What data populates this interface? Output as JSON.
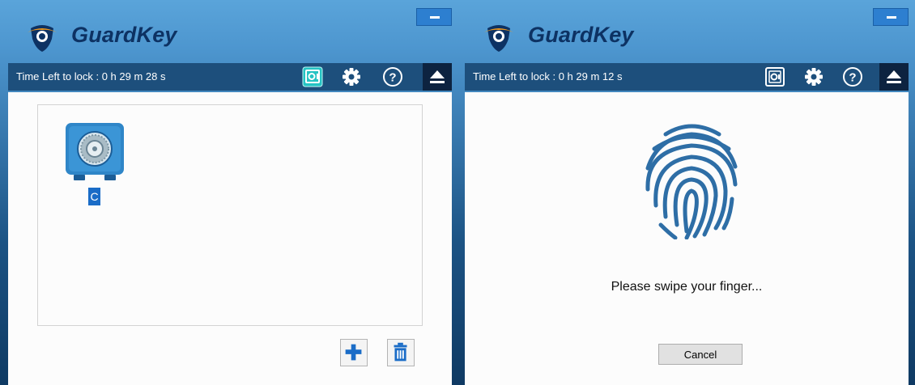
{
  "left": {
    "brand": "GuardKey",
    "timer": "Time Left to lock : 0 h 29 m 28 s",
    "vault_label": "C",
    "icons": {
      "minimize": "minimize-icon",
      "vault": "vault-icon",
      "settings": "gear-icon",
      "help": "help-icon",
      "eject": "eject-icon",
      "add": "plus-icon",
      "delete": "trash-icon"
    }
  },
  "right": {
    "brand": "GuardKey",
    "timer": "Time Left to lock : 0 h 29 m 12 s",
    "prompt": "Please swipe your finger...",
    "cancel_label": "Cancel",
    "icons": {
      "minimize": "minimize-icon",
      "vault": "vault-icon",
      "settings": "gear-icon",
      "help": "help-icon",
      "eject": "eject-icon",
      "fingerprint": "fingerprint-icon"
    }
  },
  "colors": {
    "titlebar": "#5aa4da",
    "toolbar": "#1d4f7c",
    "brand_text": "#0d3263",
    "accent_blue": "#2f86c8",
    "active_vault_icon": "#25c3c3"
  }
}
